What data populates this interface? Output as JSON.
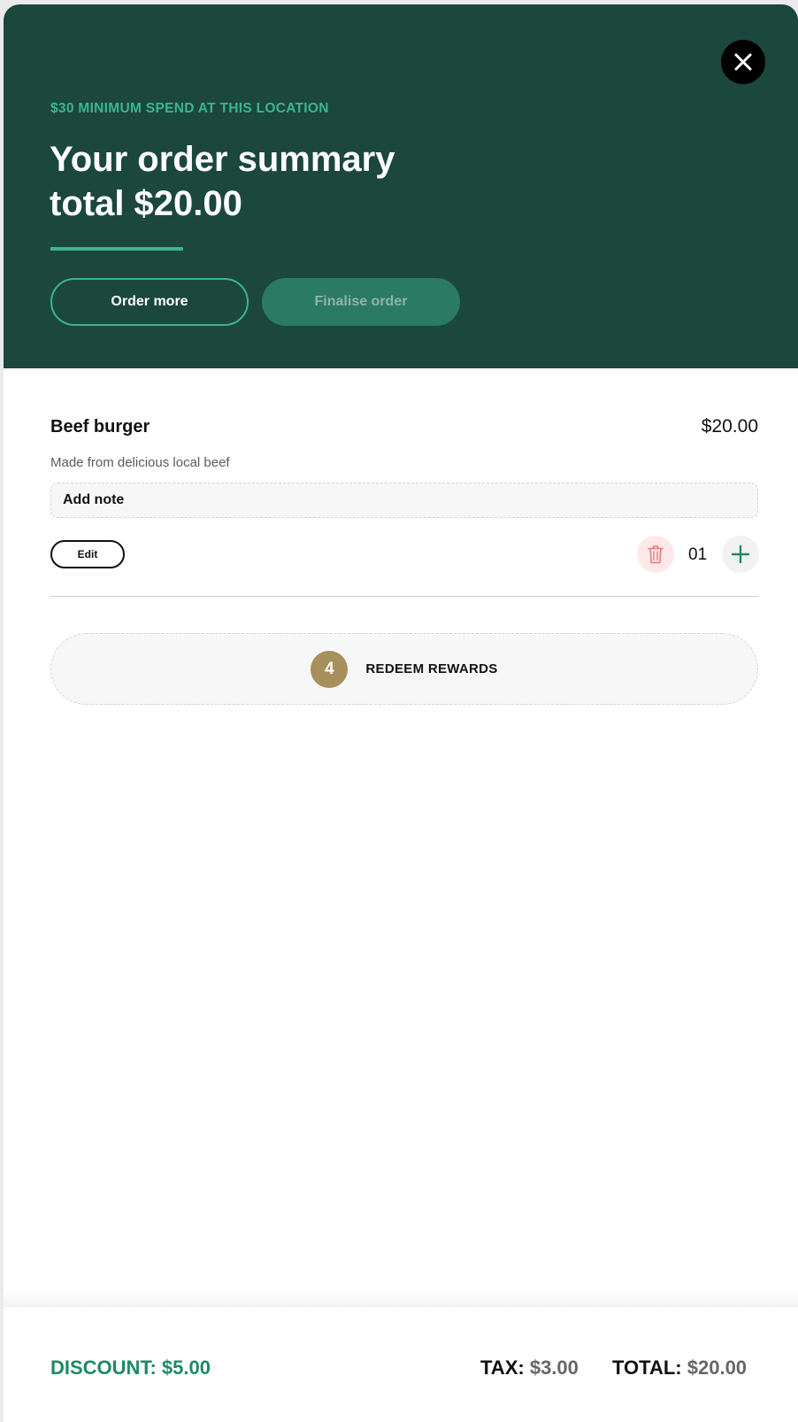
{
  "header": {
    "minimum_notice": "$30 MINIMUM SPEND AT THIS LOCATION",
    "title": "Your order summary total $20.00",
    "order_more_label": "Order more",
    "finalise_label": "Finalise order",
    "close_icon": "close-icon"
  },
  "item": {
    "name": "Beef burger",
    "price": "$20.00",
    "description": "Made from delicious local beef",
    "add_note_label": "Add note",
    "edit_label": "Edit",
    "quantity": "01",
    "delete_icon": "trash-icon",
    "add_icon": "plus-icon"
  },
  "rewards": {
    "count": "4",
    "label": "REDEEM REWARDS"
  },
  "footer": {
    "discount": "DISCOUNT: $5.00",
    "tax_label": "TAX:",
    "tax_value": "$3.00",
    "total_label": "TOTAL:",
    "total_value": "$20.00"
  },
  "colors": {
    "header_bg": "#1b473c",
    "accent": "#3bb58c",
    "finalise_bg": "#2b7a63",
    "discount": "#1f8a64",
    "rewards_badge": "#a78f5e",
    "delete_bg": "#fde9e9",
    "delete_icon": "#e77b7b"
  }
}
